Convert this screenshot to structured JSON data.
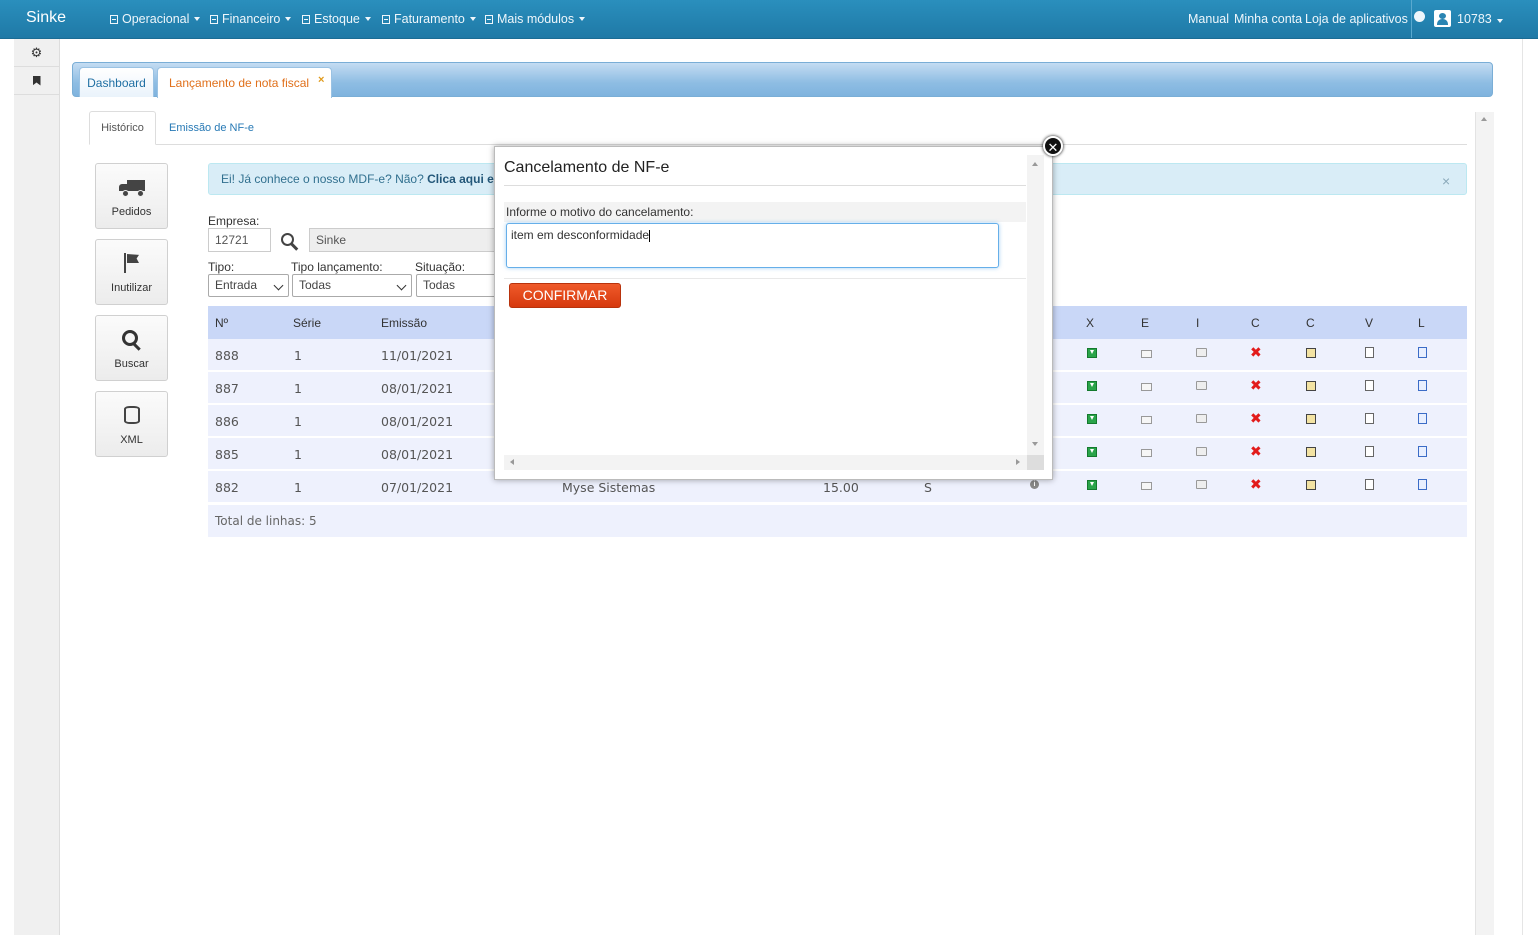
{
  "app": {
    "brand": "Sinke"
  },
  "nav": {
    "menus": [
      "Operacional",
      "Financeiro",
      "Estoque",
      "Faturamento",
      "Mais módulos"
    ],
    "links": [
      "Manual",
      "Minha conta",
      "Loja de aplicativos"
    ],
    "user": "10783"
  },
  "tabs": {
    "dashboard": "Dashboard",
    "active": "Lançamento de nota fiscal",
    "close": "×"
  },
  "subtabs": {
    "history": "Histórico",
    "emission": "Emissão de NF-e"
  },
  "sidebar": [
    "Pedidos",
    "Inutilizar",
    "Buscar",
    "XML"
  ],
  "alert": {
    "text": "Ei! Já conhece o nosso MDF-e? Não? ",
    "link": "Clica aqui e s",
    "close": "×"
  },
  "form": {
    "empresa_label": "Empresa:",
    "empresa_code": "12721",
    "empresa_name": "Sinke",
    "tipo_label": "Tipo:",
    "tipo_value": "Entrada",
    "tipo_lanc_label": "Tipo lançamento:",
    "tipo_lanc_value": "Todas",
    "situacao_label": "Situação:",
    "situacao_value": "Todas"
  },
  "table": {
    "headers": {
      "num": "Nº",
      "serie": "Série",
      "emissao": "Emissão",
      "x": "X",
      "e": "E",
      "i": "I",
      "c1": "C",
      "c2": "C",
      "v": "V",
      "l": "L"
    },
    "rows": [
      {
        "num": "888",
        "serie": "1",
        "emissao": "11/01/2021"
      },
      {
        "num": "887",
        "serie": "1",
        "emissao": "08/01/2021"
      },
      {
        "num": "886",
        "serie": "1",
        "emissao": "08/01/2021"
      },
      {
        "num": "885",
        "serie": "1",
        "emissao": "08/01/2021"
      },
      {
        "num": "882",
        "serie": "1",
        "emissao": "07/01/2021",
        "cliente": "Myse Sistemas",
        "valor": "15.00",
        "status": "S"
      }
    ],
    "total": "Total de linhas: 5"
  },
  "modal": {
    "title": "Cancelamento de NF-e",
    "label": "Informe o motivo do cancelamento:",
    "reason": "item em desconformidade",
    "confirm": "CONFIRMAR"
  }
}
